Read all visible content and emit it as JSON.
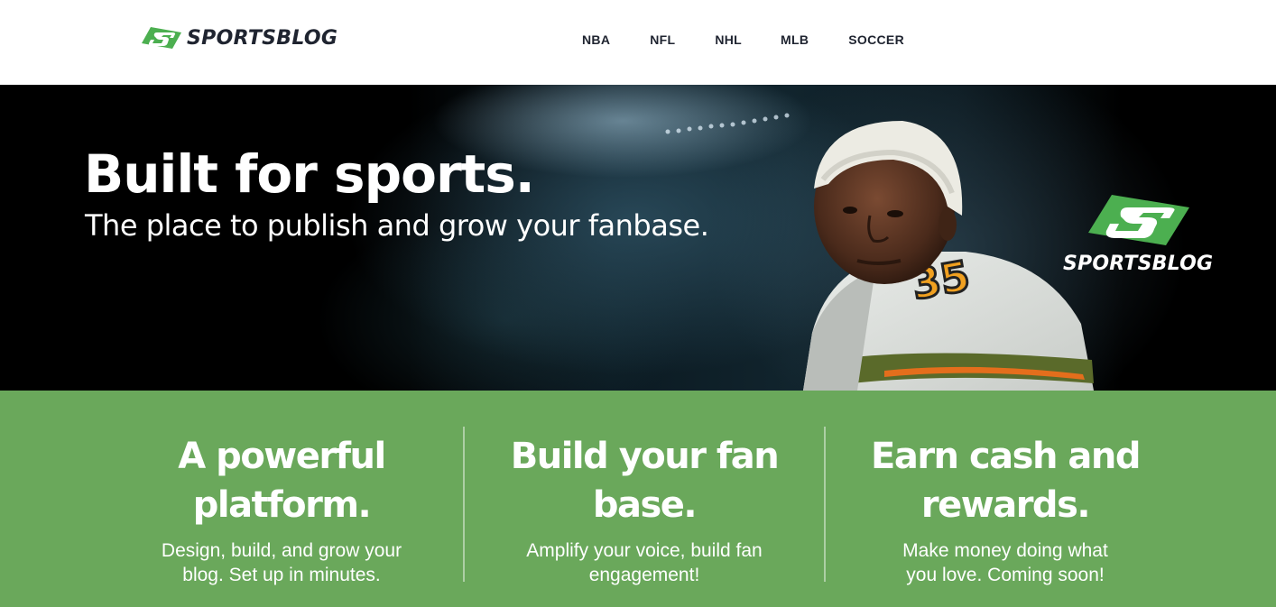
{
  "header": {
    "logo_text": "SPORTSBLOG",
    "nav": [
      {
        "label": "NBA"
      },
      {
        "label": "NFL"
      },
      {
        "label": "NHL"
      },
      {
        "label": "MLB"
      },
      {
        "label": "SOCCER"
      }
    ]
  },
  "hero": {
    "title": "Built for sports.",
    "subtitle": "The place to publish and grow your fanbase.",
    "logo_text": "SPORTSBLOG",
    "jersey_number": "35"
  },
  "features": [
    {
      "title_line1": "A powerful",
      "title_line2": "platform.",
      "text_line1": "Design, build, and grow your",
      "text_line2": "blog. Set up in minutes."
    },
    {
      "title_line1": "Build your fan",
      "title_line2": "base.",
      "text_line1": "Amplify your voice, build fan",
      "text_line2": "engagement!"
    },
    {
      "title_line1": "Earn cash and",
      "title_line2": "rewards.",
      "text_line1": "Make money doing what",
      "text_line2": "you love. Coming soon!"
    }
  ],
  "colors": {
    "brand_green": "#6aa85b",
    "logo_green": "#4caf50",
    "dark_text": "#1f2430",
    "hero_bg": "#000000"
  },
  "icons": {
    "logo_mark": "sportsblog-s-logo-icon"
  }
}
